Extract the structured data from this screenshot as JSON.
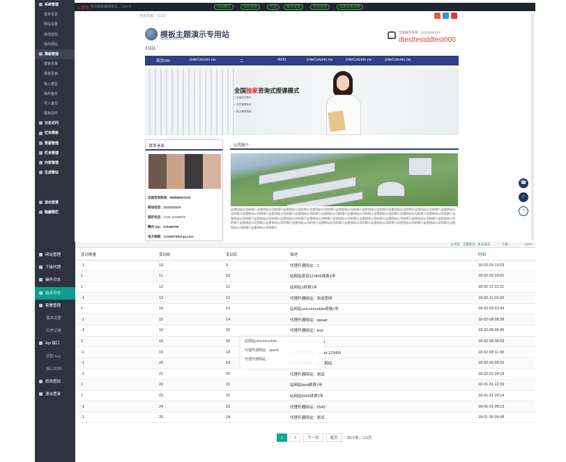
{
  "top": {
    "toolbar_title": "1 后台",
    "toolbar_sub": "当前模板编辑模式，Ctrl+S",
    "toolbar_tags": [
      "代码模式",
      "保存重用",
      "可视",
      "静态变量",
      "全局标签",
      "动态标签调用"
    ],
    "crumb": "当前页面：21111",
    "sidebar": [
      {
        "label": "系统管理",
        "type": "head"
      },
      {
        "label": "基本信息",
        "type": "sub"
      },
      {
        "label": "网站设置",
        "type": "sub"
      },
      {
        "label": "修改密码",
        "type": "sub"
      },
      {
        "label": "我的网站",
        "type": "sub"
      },
      {
        "label": "模板管理",
        "type": "head active"
      },
      {
        "label": "模板变量",
        "type": "sub"
      },
      {
        "label": "模板页面",
        "type": "sub"
      },
      {
        "label": "输入模型",
        "type": "sub"
      },
      {
        "label": "我的备份",
        "type": "sub"
      },
      {
        "label": "导入备份",
        "type": "sub"
      },
      {
        "label": "模板插件",
        "type": "sub"
      },
      {
        "label": "日志访问",
        "type": "head"
      },
      {
        "label": "栏目模板",
        "type": "head"
      },
      {
        "label": "数据管理",
        "type": "head"
      },
      {
        "label": "栏目管理",
        "type": "head"
      },
      {
        "label": "内容管理",
        "type": "head"
      },
      {
        "label": "生成整站",
        "type": "head"
      },
      {
        "label": "",
        "type": "spacer"
      },
      {
        "label": "",
        "type": "spacer"
      },
      {
        "label": "退出登录",
        "type": "head"
      },
      {
        "label": "隐藏侧栏",
        "type": "head"
      }
    ],
    "site": {
      "title": "模板主题演示专用站",
      "title_en": "MEMBER DEMO SITE",
      "num": "21111",
      "phone_label": "全国服务热线：12312344124",
      "phone": "dtesttestddtest000",
      "nav": [
        "首页000",
        "{siteColumn.na",
        "二",
        "0000",
        "{siteColumn.na",
        "{siteColumn.na",
        "{siteColumn.na"
      ],
      "banner_title_a": "全国",
      "banner_title_hl": "独家",
      "banner_title_b": "咨询式授课模式",
      "banner_lines": [
        "✓ 全面的式教学",
        "✓ 学员管理系统",
        "✓ 就业辅导制度"
      ],
      "contact_title": "联系信息",
      "contact_lines": [
        {
          "k": "全国咨询热线：",
          "v": "888888833333"
        },
        {
          "k": "移动电话：",
          "v": "2222222222"
        },
        {
          "k": "固定电话：",
          "v": "1234-12345678"
        },
        {
          "k": "腾讯 QQ：",
          "v": "123456789"
        },
        {
          "k": "电子邮箱：",
          "v": "123456789@qq.com"
        }
      ],
      "about_title": "公司简介",
      "about_text": "这是网站公司的简介这是网站公司的简介这是网站公司的简介这是网站公司的简介这是网站公司的简介这是网站公司的简介这是网站公司的简介这是网站公司的简介这是网站公司的简介这是网站公司的简介这是网站公司的简介这是网站公司的简介这是网站公司的简介这是网站公司的简介这是网站公司的简介这是网站公司的简介这是网站公司的简介这是网站公司的简介这是网站公司的简介这是网站公司的简介这是网站公司的简介这是网站公司的简介这是网站公司的简介这是网站公司的简介这是网站公司的简介这是网站公司的简介这是网站公司的简介这是网站公司的简介这是网站公司的简介这是网站公司的简介这是网站公司的简介这是网站公司的简介这是网站公司的简介这是网站公司的简介这是网站公司的简介这是网站公司的简介"
    }
  },
  "bottom": {
    "bar_left": "当前位置",
    "bar_right_items": [
      "分享链",
      "全部关注",
      "关注动态",
      "下载"
    ],
    "zoom": "100%",
    "sidebar": [
      {
        "label": "网站管理",
        "type": "head"
      },
      {
        "label": "下级代理",
        "type": "head"
      },
      {
        "label": "操作日志",
        "type": "head"
      },
      {
        "label": "站点日志",
        "type": "head active"
      },
      {
        "label": "套餐管理",
        "type": "head"
      },
      {
        "label": "基本设置",
        "type": "sub"
      },
      {
        "label": "历史记录",
        "type": "sub"
      },
      {
        "label": "Api 接口",
        "type": "head"
      },
      {
        "label": "获取 key",
        "type": "sub"
      },
      {
        "label": "接口文档",
        "type": "sub"
      },
      {
        "label": "修改密码",
        "type": "head"
      },
      {
        "label": "退出登录",
        "type": "head"
      }
    ],
    "columns": [
      "变动数量",
      "变动前",
      "变动后",
      "描述",
      "时间"
    ],
    "rows": [
      [
        "-1",
        "10",
        "9",
        "代理开通网站：1",
        "18-02-20 10:03"
      ],
      [
        "1",
        "11",
        "10",
        "站网站测试123456续费1年",
        "18-02-20 10:01"
      ],
      [
        "1",
        "12",
        "11",
        "站网站1续费1年",
        "18-02-11 10:22"
      ],
      [
        "-1",
        "13",
        "12",
        "代理开通网站：测试官网",
        "18-02-11 02:29"
      ],
      [
        "1",
        "14",
        "13",
        "站网站unicommobile续费1年",
        "18-02-09 01:43"
      ],
      [
        "-1",
        "15",
        "14",
        "代理开通网站：qasad",
        "18-02-08 08:39"
      ],
      [
        "-1",
        "16",
        "15",
        "代理开通网站：test",
        "18-02-08 06:46"
      ],
      [
        "2",
        "18",
        "16",
        "站网站unicommobile",
        "18-02-08 06:03"
      ],
      [
        "-1",
        "19",
        "18",
        "代理开通网站：qasad 123456",
        "18-02-08 11:38"
      ],
      [
        "-1",
        "20",
        "19",
        "代理开通网站：测试网站",
        "18-02-05 09:16"
      ],
      [
        "-1",
        "21",
        "20",
        "代理开通网站：测试",
        "18-02-01 04:18"
      ],
      [
        "1",
        "22",
        "21",
        "站网站fasd续费1年",
        "18-01-31 12:33"
      ],
      [
        "1",
        "23",
        "22",
        "站网站5545续费1年",
        "18-01-31 09:14"
      ],
      [
        "-1",
        "24",
        "23",
        "代理开通网站：5545",
        "18-01-31 09:13"
      ],
      [
        "-1",
        "25",
        "24",
        "代理开通网站：测试",
        "18-01-30 05:08"
      ]
    ],
    "overlay": [
      "站网站unicommobile...",
      "代理开通网站：qasad",
      "代理开通网站..."
    ],
    "pager": {
      "current": "1",
      "next_page": "2",
      "next_label": "下一页",
      "last_label": "尾页",
      "info": "共21条，1/2页"
    }
  },
  "colors": {
    "sidebar": "#2d3440",
    "accent": "#10a693",
    "nav": "#2e3f86",
    "phone": "#e03a3a"
  }
}
